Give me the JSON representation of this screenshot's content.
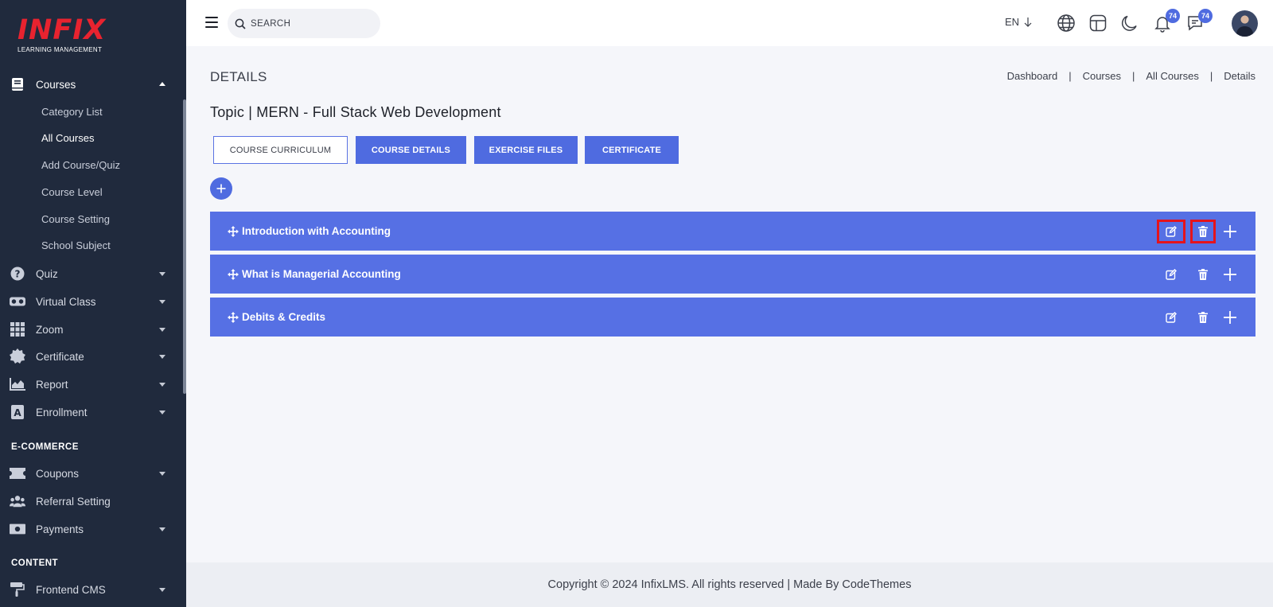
{
  "brand": {
    "logo_text": "INFIX",
    "logo_sub": "LEARNING MANAGEMENT"
  },
  "sidebar": {
    "items": [
      {
        "label": "Courses",
        "icon": "book-icon",
        "expanded": true
      },
      {
        "label": "Quiz",
        "icon": "question-circle-icon"
      },
      {
        "label": "Virtual Class",
        "icon": "vr-headset-icon"
      },
      {
        "label": "Zoom",
        "icon": "grid-icon"
      },
      {
        "label": "Certificate",
        "icon": "badge-icon"
      },
      {
        "label": "Report",
        "icon": "area-chart-icon"
      },
      {
        "label": "Enrollment",
        "icon": "enrollment-icon"
      },
      {
        "label": "Coupons",
        "icon": "ticket-icon"
      },
      {
        "label": "Referral Setting",
        "icon": "users-icon"
      },
      {
        "label": "Payments",
        "icon": "money-icon"
      },
      {
        "label": "Frontend CMS",
        "icon": "paint-roller-icon"
      }
    ],
    "course_sub": [
      "Category List",
      "All Courses",
      "Add Course/Quiz",
      "Course Level",
      "Course Setting",
      "School Subject"
    ],
    "sections": {
      "ecommerce": "E-COMMERCE",
      "content": "CONTENT"
    }
  },
  "header": {
    "search_placeholder": "SEARCH",
    "language": "EN",
    "notifications_count": "74",
    "messages_count": "74"
  },
  "page": {
    "title": "DETAILS",
    "breadcrumb": [
      "Dashboard",
      "Courses",
      "All Courses",
      "Details"
    ],
    "topic_title": "Topic | MERN - Full Stack Web Development",
    "tabs": [
      "COURSE CURRICULUM",
      "COURSE DETAILS",
      "EXERCISE FILES",
      "CERTIFICATE"
    ],
    "chapters": [
      "Introduction with Accounting",
      "What is Managerial Accounting",
      "Debits & Credits"
    ]
  },
  "footer": {
    "text": "Copyright © 2024 InfixLMS. All rights reserved | Made By CodeThemes"
  },
  "colors": {
    "primary": "#4f6be0",
    "sidebar": "#202a3d",
    "highlight": "#e5131c",
    "brand_red": "#e8232f"
  }
}
